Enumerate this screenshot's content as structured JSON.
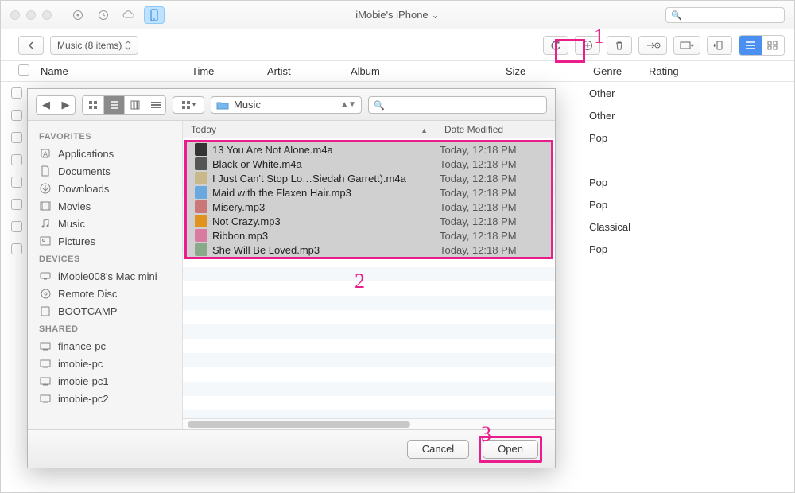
{
  "window": {
    "title": "iMobie's iPhone"
  },
  "toolbar": {
    "breadcrumb": "Music (8 items)"
  },
  "columns": {
    "name": "Name",
    "time": "Time",
    "artist": "Artist",
    "album": "Album",
    "size": "Size",
    "genre": "Genre",
    "rating": "Rating"
  },
  "bg_rows": [
    {
      "genre": "Other"
    },
    {
      "genre": "Other"
    },
    {
      "genre": "Pop"
    },
    {
      "genre": ""
    },
    {
      "genre": "Pop"
    },
    {
      "genre": "Pop"
    },
    {
      "genre": "Classical"
    },
    {
      "genre": "Pop"
    }
  ],
  "dialog": {
    "path_label": "Music",
    "sidebar": {
      "favorites_head": "FAVORITES",
      "favorites": [
        "Applications",
        "Documents",
        "Downloads",
        "Movies",
        "Music",
        "Pictures"
      ],
      "devices_head": "DEVICES",
      "devices": [
        "iMobie008's Mac mini",
        "Remote Disc",
        "BOOTCAMP"
      ],
      "shared_head": "SHARED",
      "shared": [
        "finance-pc",
        "imobie-pc",
        "imobie-pc1",
        "imobie-pc2"
      ]
    },
    "filehead": {
      "today": "Today",
      "date_modified": "Date Modified"
    },
    "files": [
      {
        "name": "13 You Are Not Alone.m4a",
        "date": "Today, 12:18 PM",
        "color": "#333"
      },
      {
        "name": "Black or White.m4a",
        "date": "Today, 12:18 PM",
        "color": "#555"
      },
      {
        "name": "I Just Can't Stop Lo…Siedah Garrett).m4a",
        "date": "Today, 12:18 PM",
        "color": "#c9b88a"
      },
      {
        "name": "Maid with the Flaxen Hair.mp3",
        "date": "Today, 12:18 PM",
        "color": "#6aa9e0"
      },
      {
        "name": "Misery.mp3",
        "date": "Today, 12:18 PM",
        "color": "#c77"
      },
      {
        "name": "Not Crazy.mp3",
        "date": "Today, 12:18 PM",
        "color": "#e0941f"
      },
      {
        "name": "Ribbon.mp3",
        "date": "Today, 12:18 PM",
        "color": "#d97ba0"
      },
      {
        "name": "She Will Be Loved.mp3",
        "date": "Today, 12:18 PM",
        "color": "#8a8"
      }
    ],
    "buttons": {
      "cancel": "Cancel",
      "open": "Open"
    }
  },
  "callouts": {
    "one": "1",
    "two": "2",
    "three": "3"
  },
  "icons": {
    "fav": [
      "app",
      "doc",
      "download",
      "movie",
      "music",
      "picture"
    ],
    "dev": [
      "mac",
      "disc",
      "disk"
    ],
    "share": [
      "pc",
      "pc",
      "pc",
      "pc"
    ]
  }
}
